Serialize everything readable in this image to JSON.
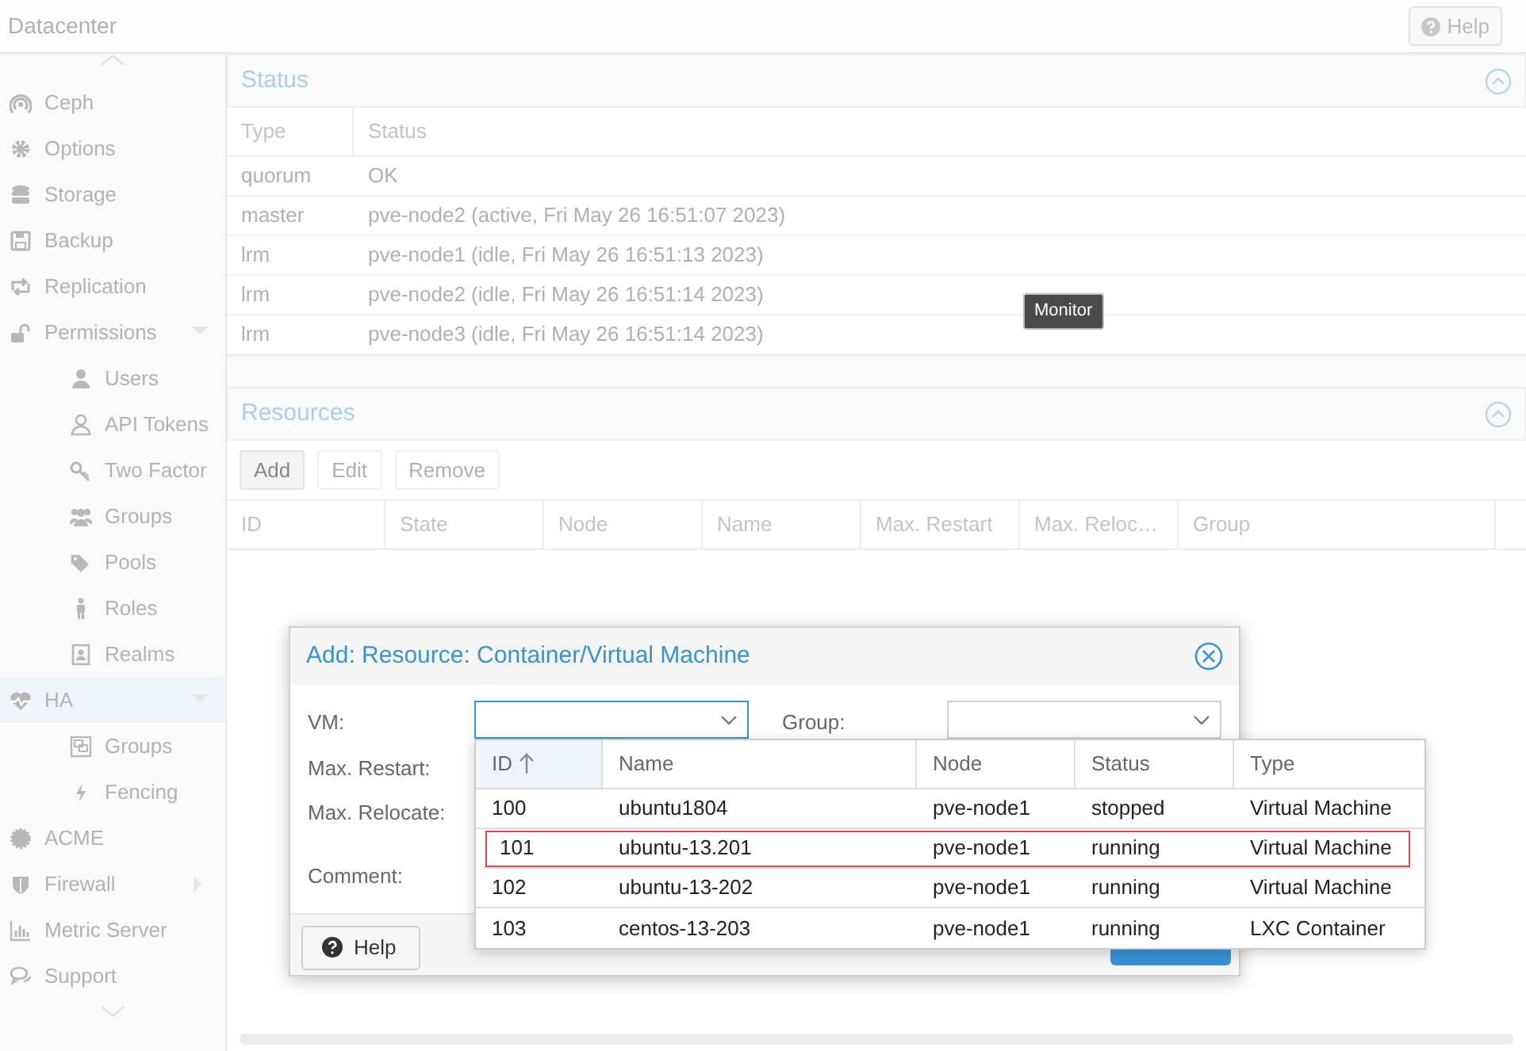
{
  "header": {
    "title": "Datacenter",
    "help_button": "Help"
  },
  "sidebar": {
    "items": [
      {
        "label": "Ceph",
        "selected": false
      },
      {
        "label": "Options",
        "selected": false
      },
      {
        "label": "Storage",
        "selected": false
      },
      {
        "label": "Backup",
        "selected": false
      },
      {
        "label": "Replication",
        "selected": false
      },
      {
        "label": "Permissions",
        "selected": false,
        "expanded": true,
        "children": [
          {
            "label": "Users",
            "selected": false
          },
          {
            "label": "API Tokens",
            "selected": false
          },
          {
            "label": "Two Factor",
            "selected": false
          },
          {
            "label": "Groups",
            "selected": false
          },
          {
            "label": "Pools",
            "selected": false
          },
          {
            "label": "Roles",
            "selected": false
          },
          {
            "label": "Realms",
            "selected": false
          }
        ]
      },
      {
        "label": "HA",
        "selected": true,
        "expanded": true,
        "children": [
          {
            "label": "Groups",
            "selected": false
          },
          {
            "label": "Fencing",
            "selected": false
          }
        ]
      },
      {
        "label": "ACME",
        "selected": false
      },
      {
        "label": "Firewall",
        "selected": false,
        "expanded": false
      },
      {
        "label": "Metric Server",
        "selected": false
      },
      {
        "label": "Support",
        "selected": false
      }
    ]
  },
  "status_panel": {
    "title": "Status",
    "columns": [
      "Type",
      "Status"
    ],
    "rows": [
      [
        "quorum",
        "OK"
      ],
      [
        "master",
        "pve-node2 (active, Fri May 26 16:51:07 2023)"
      ],
      [
        "lrm",
        "pve-node1 (idle, Fri May 26 16:51:13 2023)"
      ],
      [
        "lrm",
        "pve-node2 (idle, Fri May 26 16:51:14 2023)"
      ],
      [
        "lrm",
        "pve-node3 (idle, Fri May 26 16:51:14 2023)"
      ]
    ]
  },
  "tooltip": "Monitor",
  "resources_panel": {
    "title": "Resources",
    "toolbar": [
      {
        "label": "Add",
        "disabled": false
      },
      {
        "label": "Edit",
        "disabled": true
      },
      {
        "label": "Remove",
        "disabled": true
      }
    ],
    "columns": [
      "ID",
      "State",
      "Node",
      "Name",
      "Max. Restart",
      "Max. Reloc…",
      "Group"
    ]
  },
  "dialog": {
    "title": "Add: Resource: Container/Virtual Machine",
    "fields": [
      {
        "label": "VM:",
        "kind": "combo",
        "focused": true
      },
      {
        "label": "Group:",
        "kind": "combo",
        "focused": false
      },
      {
        "label": "Max. Restart:",
        "kind": "label"
      },
      {
        "label": "Max. Relocate:",
        "kind": "label"
      },
      {
        "label": "Comment:",
        "kind": "label"
      }
    ],
    "help_button": "Help",
    "picker": {
      "columns": [
        {
          "label": "ID",
          "sorted": true
        },
        {
          "label": "Name",
          "sorted": false
        },
        {
          "label": "Node",
          "sorted": false
        },
        {
          "label": "Status",
          "sorted": false
        },
        {
          "label": "Type",
          "sorted": false
        }
      ],
      "rows": [
        {
          "cells": [
            "100",
            "ubuntu1804",
            "pve-node1",
            "stopped",
            "Virtual Machine"
          ],
          "selected": false
        },
        {
          "cells": [
            "101",
            "ubuntu-13.201",
            "pve-node1",
            "running",
            "Virtual Machine"
          ],
          "selected": true
        },
        {
          "cells": [
            "102",
            "ubuntu-13-202",
            "pve-node1",
            "running",
            "Virtual Machine"
          ],
          "selected": false
        },
        {
          "cells": [
            "103",
            "centos-13-203",
            "pve-node1",
            "running",
            "LXC Container"
          ],
          "selected": false
        }
      ]
    }
  }
}
